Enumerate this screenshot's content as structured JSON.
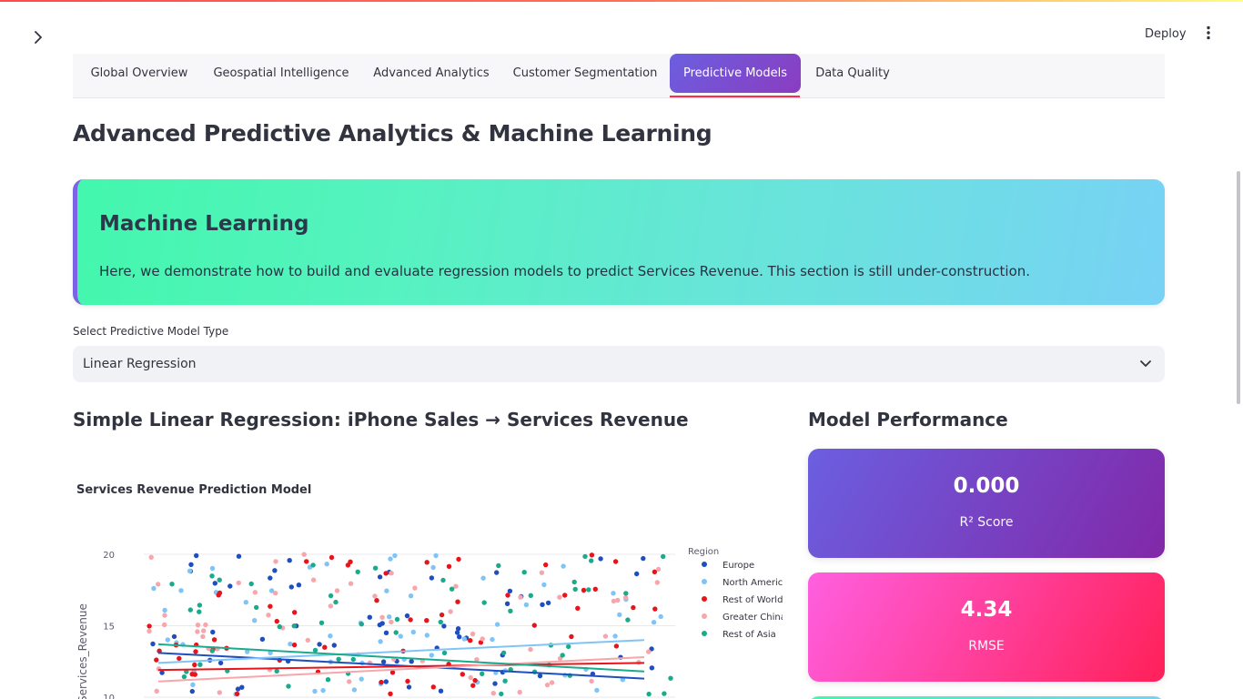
{
  "header": {
    "deploy_label": "Deploy",
    "sidebar_icon": "chevron-right-icon",
    "menu_icon": "more-vertical-icon"
  },
  "tabs": [
    {
      "label": "Global Overview",
      "active": false
    },
    {
      "label": "Geospatial Intelligence",
      "active": false
    },
    {
      "label": "Advanced Analytics",
      "active": false
    },
    {
      "label": "Customer Segmentation",
      "active": false
    },
    {
      "label": "Predictive Models",
      "active": true
    },
    {
      "label": "Data Quality",
      "active": false
    }
  ],
  "page_title": "Advanced Predictive Analytics & Machine Learning",
  "hero": {
    "title": "Machine Learning",
    "text": "Here, we demonstrate how to build and evaluate regression models to predict Services Revenue. This section is still under-construction."
  },
  "model_select": {
    "label": "Select Predictive Model Type",
    "value": "Linear Regression"
  },
  "regression_section": {
    "title": "Simple Linear Regression: iPhone Sales → Services Revenue"
  },
  "performance_section": {
    "title": "Model Performance",
    "metrics": [
      {
        "value": "0.000",
        "label": "R² Score"
      },
      {
        "value": "4.34",
        "label": "RMSE"
      }
    ]
  },
  "colors": {
    "accent": "#ff2b4b",
    "tab_active_start": "#6b5fe0",
    "tab_active_end": "#8b3cc0",
    "card_r2_start": "#6b5fe0",
    "card_r2_end": "#8128a8",
    "card_rmse_start": "#ff5fe0",
    "card_rmse_end": "#ff2058"
  },
  "chart_data": {
    "type": "scatter",
    "title": "Services Revenue Prediction Model",
    "ylabel": "Services_Revenue",
    "ylim": [
      10,
      20
    ],
    "y_ticks": [
      "20",
      "15",
      "10"
    ],
    "legend_title": "Region",
    "legend_position": "right",
    "series": [
      {
        "name": "Europe",
        "color": "#1f4fbf",
        "trend": [
          13.1,
          11.3
        ]
      },
      {
        "name": "North America",
        "color": "#80c4f7",
        "trend": [
          12.4,
          14.0
        ]
      },
      {
        "name": "Rest of World",
        "color": "#e8141a",
        "trend": [
          11.9,
          12.4
        ]
      },
      {
        "name": "Greater China",
        "color": "#f7a6ab",
        "trend": [
          11.1,
          12.8
        ]
      },
      {
        "name": "Rest of Asia",
        "color": "#1aab8c",
        "trend": [
          13.7,
          11.8
        ]
      }
    ]
  }
}
